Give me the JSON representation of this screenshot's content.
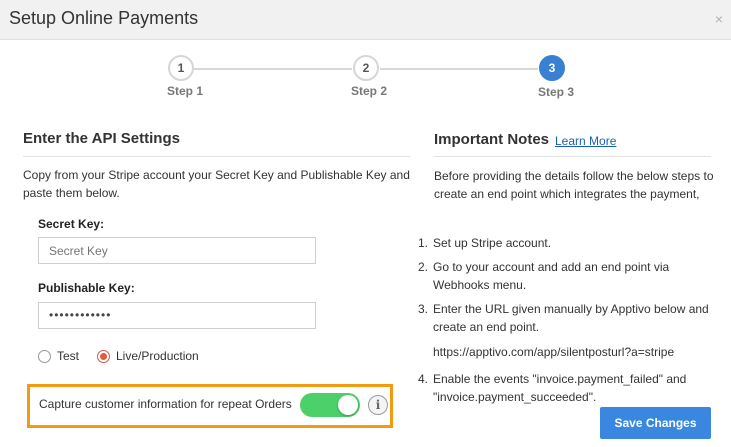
{
  "dialog": {
    "title": "Setup Online Payments",
    "close_icon": "×"
  },
  "stepper": {
    "steps": [
      {
        "number": "1",
        "label": "Step 1",
        "active": false
      },
      {
        "number": "2",
        "label": "Step 2",
        "active": false
      },
      {
        "number": "3",
        "label": "Step 3",
        "active": true
      }
    ]
  },
  "api_settings": {
    "title": "Enter the API Settings",
    "description": "Copy from your Stripe account your Secret Key and Publishable Key and paste them below.",
    "secret_key": {
      "label": "Secret Key:",
      "placeholder": "Secret Key",
      "value": ""
    },
    "publishable_key": {
      "label": "Publishable Key:",
      "value": "••••••••••••"
    },
    "mode": {
      "options": [
        {
          "label": "Test",
          "checked": false
        },
        {
          "label": "Live/Production",
          "checked": true
        }
      ]
    },
    "capture": {
      "label": "Capture customer information for repeat Orders",
      "enabled": true,
      "info_icon": "i"
    }
  },
  "notes": {
    "title": "Important Notes",
    "learn_more": "Learn More",
    "intro": "Before providing the details follow the below steps to create an end point which integrates the payment,",
    "items": [
      {
        "num": "1.",
        "text": "Set up Stripe account."
      },
      {
        "num": "2.",
        "text": "Go to your account and add an end point via Webhooks menu."
      },
      {
        "num": "3.",
        "text": "Enter the URL given manually by Apptivo below and create an end point.",
        "url": "https://apptivo.com/app/silentposturl?a=stripe"
      },
      {
        "num": "4.",
        "text": "Enable the events \"invoice.payment_failed\" and \"invoice.payment_succeeded\"."
      }
    ]
  },
  "actions": {
    "save_label": "Save Changes"
  },
  "colors": {
    "accent": "#3a80d2",
    "toggle_on": "#4cd06a",
    "highlight_border": "#f29b12",
    "radio_checked": "#e25b3d",
    "link": "#1b5fb5"
  }
}
